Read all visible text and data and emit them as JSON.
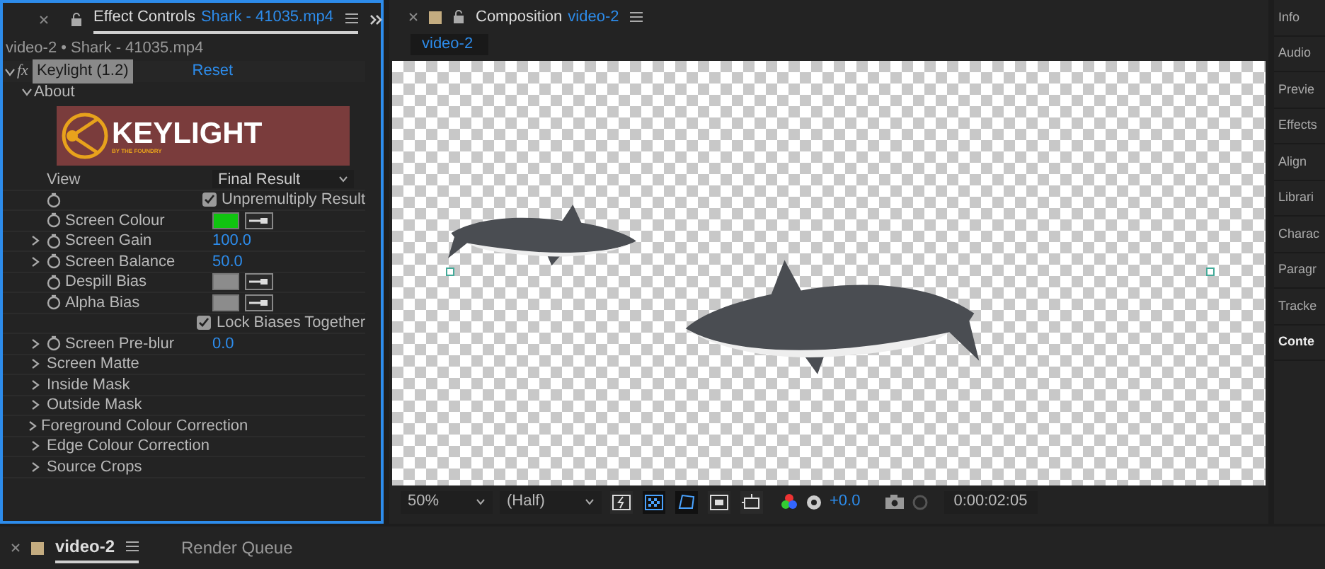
{
  "effect_controls": {
    "tab_title": "Effect Controls",
    "tab_file": "Shark - 41035.mp4",
    "layer_path": "video-2 • Shark - 41035.mp4",
    "effect": {
      "fx": "fx",
      "name": "Keylight (1.2)",
      "reset": "Reset",
      "expanded": true
    },
    "about": {
      "label": "About",
      "expanded": true
    },
    "logo": {
      "text": "KEYLIGHT",
      "subtext": "BY THE FOUNDRY"
    },
    "properties": [
      {
        "kind": "dropdown",
        "label": "View",
        "value": "Final Result",
        "stopwatch": false
      },
      {
        "kind": "checkbox",
        "value": "Unpremultiply Result",
        "checked": true,
        "stopwatch": true
      },
      {
        "kind": "color",
        "label": "Screen Colour",
        "color": "#10c410",
        "stopwatch": true
      },
      {
        "kind": "number",
        "label": "Screen Gain",
        "value": "100.0",
        "stopwatch": true,
        "expanded": false
      },
      {
        "kind": "number",
        "label": "Screen Balance",
        "value": "50.0",
        "stopwatch": true,
        "expanded": false
      },
      {
        "kind": "color",
        "label": "Despill Bias",
        "color": "#8c8c8c",
        "stopwatch": true
      },
      {
        "kind": "color",
        "label": "Alpha Bias",
        "color": "#8c8c8c",
        "stopwatch": true
      },
      {
        "kind": "checkbox",
        "value": "Lock Biases Together",
        "checked": true,
        "stopwatch": false
      },
      {
        "kind": "number",
        "label": "Screen Pre-blur",
        "value": "0.0",
        "stopwatch": true,
        "expanded": false
      },
      {
        "kind": "group",
        "label": "Screen Matte",
        "expanded": false
      },
      {
        "kind": "group",
        "label": "Inside Mask",
        "expanded": false
      },
      {
        "kind": "group",
        "label": "Outside Mask",
        "expanded": false
      },
      {
        "kind": "group",
        "label": "Foreground Colour Correction",
        "expanded": false
      },
      {
        "kind": "group",
        "label": "Edge Colour Correction",
        "expanded": false
      },
      {
        "kind": "group",
        "label": "Source Crops",
        "expanded": false
      }
    ]
  },
  "composition": {
    "tab_title": "Composition",
    "comp_name": "video-2",
    "comp_tab": "video-2",
    "toolbar": {
      "zoom": "50%",
      "resolution": "(Half)",
      "toggles": [
        {
          "selected": false
        },
        {
          "selected": true
        },
        {
          "selected": true
        },
        {
          "selected": false
        },
        {
          "selected": false
        }
      ],
      "exposure": "+0.0",
      "timecode": "0:00:02:05"
    }
  },
  "side_panels": [
    {
      "label": "Info",
      "selected": false
    },
    {
      "label": "Audio",
      "selected": false
    },
    {
      "label": "Previe",
      "selected": false
    },
    {
      "label": "Effects",
      "selected": false
    },
    {
      "label": "Align",
      "selected": false
    },
    {
      "label": "Librari",
      "selected": false
    },
    {
      "label": "Charac",
      "selected": false
    },
    {
      "label": "Paragr",
      "selected": false
    },
    {
      "label": "Tracke",
      "selected": false
    },
    {
      "label": "Conte",
      "selected": true
    }
  ],
  "bottom_tabs": [
    {
      "label": "video-2",
      "selected": true
    },
    {
      "label": "Render Queue",
      "selected": false
    }
  ]
}
